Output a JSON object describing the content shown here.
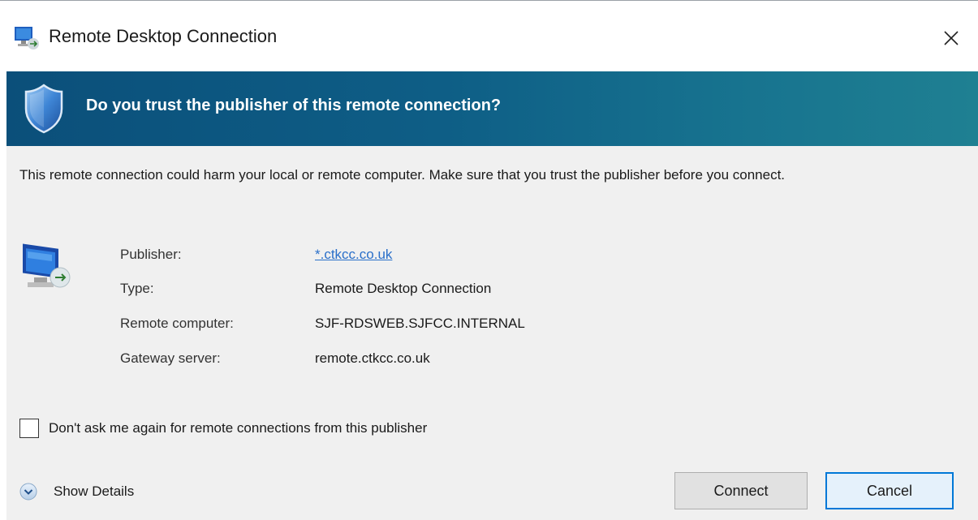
{
  "window": {
    "title": "Remote Desktop Connection",
    "app_icon": "remote-desktop-app-icon",
    "close_icon": "close-icon"
  },
  "banner": {
    "heading": "Do you trust the publisher of this remote connection?",
    "icon": "shield-icon",
    "colors": {
      "start": "#0b4f7a",
      "end": "#1f8092"
    }
  },
  "warning_text": "This remote connection could harm your local or remote computer. Make sure that you trust the publisher before you connect.",
  "details": {
    "icon": "remote-computer-icon",
    "rows": [
      {
        "label": "Publisher:",
        "value": "*.ctkcc.co.uk"
      },
      {
        "label": "Type:",
        "value": "Remote Desktop Connection"
      },
      {
        "label": "Remote computer:",
        "value": "SJF-RDSWEB.SJFCC.INTERNAL"
      },
      {
        "label": "Gateway server:",
        "value": "remote.ctkcc.co.uk"
      }
    ]
  },
  "checkbox": {
    "label": "Don't ask me again for remote connections from this publisher",
    "checked": false
  },
  "show_details": {
    "label": "Show Details",
    "icon": "chevron-down-icon"
  },
  "buttons": {
    "connect": "Connect",
    "cancel": "Cancel"
  },
  "colors": {
    "link": "#2a6fc9",
    "focus_border": "#0078d7",
    "content_bg": "#f0f0f0"
  }
}
